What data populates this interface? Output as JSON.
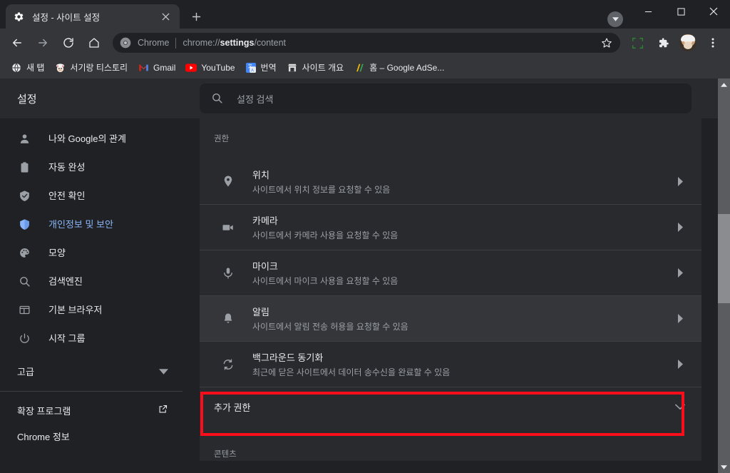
{
  "window": {
    "tab": {
      "title": "설정 - 사이트 설정",
      "favicon": "gear-icon",
      "close": "×"
    },
    "new_tab_label": "+",
    "controls": {
      "minimize": "—",
      "maximize": "□",
      "close": "✕"
    }
  },
  "toolbar": {
    "back": "←",
    "forward": "→",
    "reload": "⟳",
    "home": "⌂",
    "omnibox": {
      "chip": "Chrome",
      "url_prefix": "chrome://",
      "url_bold": "settings",
      "url_suffix": "/content",
      "star": "☆"
    },
    "capture_icon": "capture-icon",
    "extensions_icon": "puzzle-icon",
    "avatar": "profile-avatar",
    "menu": "⋮"
  },
  "bookmarks": [
    {
      "label": "새 탭",
      "icon": "globe-icon",
      "glyph": "🌐"
    },
    {
      "label": "서기랑 티스토리",
      "icon": "cow-avatar-icon",
      "glyph": "🐄"
    },
    {
      "label": "Gmail",
      "icon": "gmail-icon",
      "glyph": "M"
    },
    {
      "label": "YouTube",
      "icon": "youtube-icon",
      "glyph": "▶"
    },
    {
      "label": "번역",
      "icon": "translate-icon",
      "glyph": "G"
    },
    {
      "label": "사이트 개요",
      "icon": "store-icon",
      "glyph": "🏪"
    },
    {
      "label": "홈 – Google AdSe...",
      "icon": "adsense-icon",
      "glyph": "//"
    }
  ],
  "settings": {
    "title": "설정",
    "search": {
      "placeholder": "설정 검색",
      "icon": "search-icon"
    },
    "sidebar": {
      "items": [
        {
          "label": "나와 Google의 관계",
          "icon": "person-icon",
          "active": false
        },
        {
          "label": "자동 완성",
          "icon": "clipboard-icon",
          "active": false
        },
        {
          "label": "안전 확인",
          "icon": "shield-check-icon",
          "active": false
        },
        {
          "label": "개인정보 및 보안",
          "icon": "shield-icon",
          "active": true
        },
        {
          "label": "모양",
          "icon": "palette-icon",
          "active": false
        },
        {
          "label": "검색엔진",
          "icon": "search-icon",
          "active": false
        },
        {
          "label": "기본 브라우저",
          "icon": "browser-icon",
          "active": false
        },
        {
          "label": "시작 그룹",
          "icon": "power-icon",
          "active": false
        }
      ],
      "advanced": {
        "label": "고급",
        "icon": "chevron-down-icon"
      },
      "bottom": [
        {
          "label": "확장 프로그램",
          "icon": "external-link-icon"
        },
        {
          "label": "Chrome 정보",
          "icon": ""
        }
      ]
    },
    "content": {
      "permissions_label": "권한",
      "rows": [
        {
          "title": "위치",
          "subtitle": "사이트에서 위치 정보를 요청할 수 있음",
          "icon": "location-pin-icon",
          "arrow": "▸",
          "highlighted": false
        },
        {
          "title": "카메라",
          "subtitle": "사이트에서 카메라 사용을 요청할 수 있음",
          "icon": "camera-icon",
          "arrow": "▸",
          "highlighted": false
        },
        {
          "title": "마이크",
          "subtitle": "사이트에서 마이크 사용을 요청할 수 있음",
          "icon": "microphone-icon",
          "arrow": "▸",
          "highlighted": false
        },
        {
          "title": "알림",
          "subtitle": "사이트에서 알림 전송 허용을 요청할 수 있음",
          "icon": "bell-icon",
          "arrow": "▸",
          "highlighted": true
        },
        {
          "title": "백그라운드 동기화",
          "subtitle": "최근에 닫은 사이트에서 데이터 송수신을 완료할 수 있음",
          "icon": "sync-icon",
          "arrow": "▸",
          "highlighted": false
        }
      ],
      "additional_permissions": {
        "label": "추가 권한",
        "chevron": "⌄"
      },
      "content_label": "콘텐츠"
    }
  },
  "annotation": {
    "color": "#fc0d1b"
  },
  "scrollbar": {
    "up_arrow": "▲",
    "down_arrow": "▼"
  }
}
